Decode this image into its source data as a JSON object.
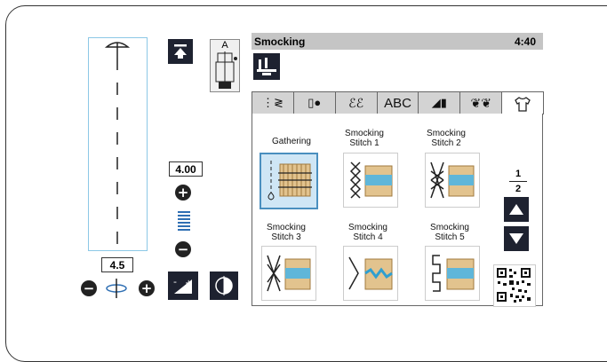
{
  "left_panel": {
    "presser_foot_letter": "A",
    "stitch_length": "4.00",
    "stitch_width": "4.5"
  },
  "screen": {
    "title": "Smocking",
    "time": "4:40",
    "tabs": [
      {
        "name": "tab-utility",
        "icon": "utility-stitch-icon",
        "glyph": "⋮≷"
      },
      {
        "name": "tab-buttonhole",
        "icon": "buttonhole-icon",
        "glyph": "▯●"
      },
      {
        "name": "tab-decorative",
        "icon": "decorative-stitch-icon",
        "glyph": "ℰℰ"
      },
      {
        "name": "tab-lettering",
        "icon": "",
        "glyph": "ABC"
      },
      {
        "name": "tab-satin",
        "icon": "satin-stitch-icon",
        "glyph": "◢▮"
      },
      {
        "name": "tab-floral",
        "icon": "floral-stitch-icon",
        "glyph": "❦❦"
      },
      {
        "name": "tab-quilt",
        "icon": "shirt-icon",
        "glyph": "👕"
      }
    ],
    "stitches": [
      {
        "label": "Gathering",
        "selected": true
      },
      {
        "label": "Smocking Stitch 1",
        "selected": false
      },
      {
        "label": "Smocking Stitch 2",
        "selected": false
      },
      {
        "label": "Smocking Stitch 3",
        "selected": false
      },
      {
        "label": "Smocking Stitch 4",
        "selected": false
      },
      {
        "label": "Smocking Stitch 5",
        "selected": false
      }
    ],
    "page": {
      "current": "1",
      "total": "2"
    }
  }
}
